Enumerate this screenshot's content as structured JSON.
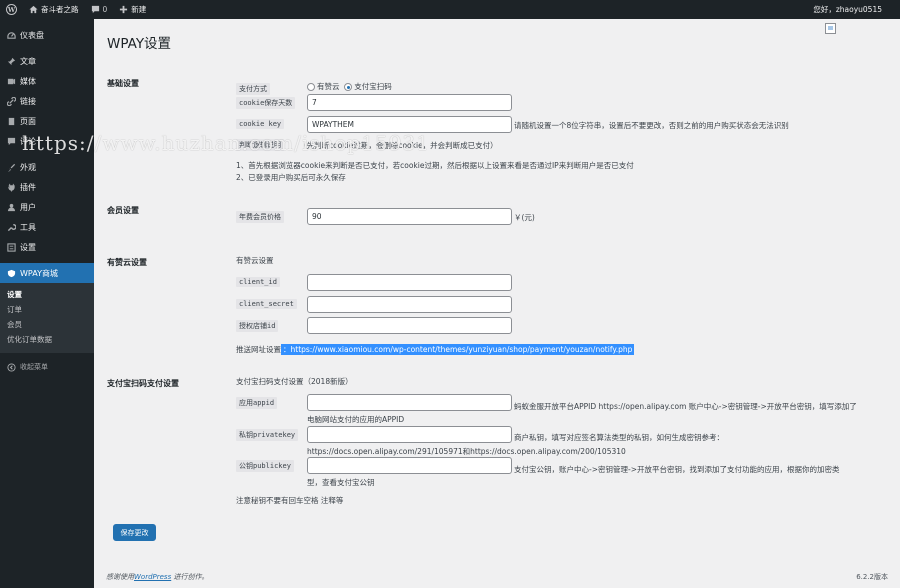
{
  "adminbar": {
    "site_name": "奋斗者之路",
    "comments_count": "0",
    "new_label": "新建",
    "greeting": "您好，zhaoyu0515"
  },
  "sidebar": {
    "items": [
      {
        "label": "仪表盘",
        "icon": "dashboard-icon"
      },
      {
        "label": "文章",
        "icon": "pin-icon"
      },
      {
        "label": "媒体",
        "icon": "media-icon"
      },
      {
        "label": "链接",
        "icon": "link-icon"
      },
      {
        "label": "页面",
        "icon": "page-icon"
      },
      {
        "label": "评论",
        "icon": "comment-icon"
      },
      {
        "label": "外观",
        "icon": "brush-icon"
      },
      {
        "label": "插件",
        "icon": "plugin-icon"
      },
      {
        "label": "用户",
        "icon": "user-icon"
      },
      {
        "label": "工具",
        "icon": "wrench-icon"
      },
      {
        "label": "设置",
        "icon": "settings-icon"
      }
    ],
    "current": {
      "label": "WPAY商城",
      "icon": "shield-icon"
    },
    "submenu": [
      "设置",
      "订单",
      "会员",
      "优化订单数据"
    ],
    "collapse_label": "收起菜单"
  },
  "page": {
    "title": "WPAY设置"
  },
  "basic": {
    "title": "基础设置",
    "pay_method_label": "支付方式",
    "pay_opt1": "有赞云",
    "pay_opt2": "支付宝扫码",
    "cookie_days_label": "cookie保存天数",
    "cookie_days_value": "7",
    "cookie_key_label": "cookie key",
    "cookie_key_value": "WPAYTHEM",
    "cookie_key_desc": "请随机设置一个8位字符串，设置后不要更改，否则之前的用户购买状态会无法识别",
    "logic_label": "判断逻辑说明",
    "logic_text": "（先判断cookie过期，会删除cookie，并会判断成已支付）",
    "rule1": "1、首先根据浏览器cookie来判断是否已支付，若cookie过期，然后根据以上设置来看是否通过IP来判断用户是否已支付",
    "rule2": "2、已登录用户购买后可永久保存"
  },
  "member": {
    "title": "会员设置",
    "price_label": "年费会员价格",
    "price_value": "90",
    "price_unit": "￥(元)"
  },
  "youzan": {
    "title": "有赞云设置",
    "subtitle": "有赞云设置",
    "client_id_label": "client_id",
    "client_secret_label": "client_secret",
    "shop_id_label": "授权店铺id",
    "notify_label": "推送网址设置",
    "notify_url": "：https://www.xiaomiou.com/wp-content/themes/yunziyuan/shop/payment/youzan/notify.php"
  },
  "alipay": {
    "title": "支付宝扫码支付设置",
    "subtitle": "支付宝扫码支付设置（2018新版）",
    "appid_label": "应用appid",
    "appid_desc": "蚂蚁金服开放平台APPID https://open.alipay.com 账户中心->密钥管理->开放平台密钥，填写添加了",
    "appid_desc2": "电脑网站支付的应用的APPID",
    "private_label": "私钥privatekey",
    "private_desc": "商户私钥，填写对应签名算法类型的私钥，如何生成密钥参考：",
    "private_desc2": "https://docs.open.alipay.com/291/105971和https://docs.open.alipay.com/200/105310",
    "public_label": "公钥publickey",
    "public_desc": "支付宝公钥，账户中心->密钥管理->开放平台密钥，找到添加了支付功能的应用，根据你的加密类",
    "public_desc2": "型，查看支付宝公钥",
    "note": "注意秘钥不要有回车空格 注释等"
  },
  "save_label": "保存更改",
  "footer": {
    "prefix": "感谢使用",
    "link": "WordPress",
    "suffix": "进行创作。",
    "version": "6.2.2版本"
  },
  "watermark": "https://www.huzhan.com/ishop15931",
  "colors": {
    "admin_dark": "#1d2327",
    "accent": "#2271b1",
    "selection": "#3390ff"
  }
}
